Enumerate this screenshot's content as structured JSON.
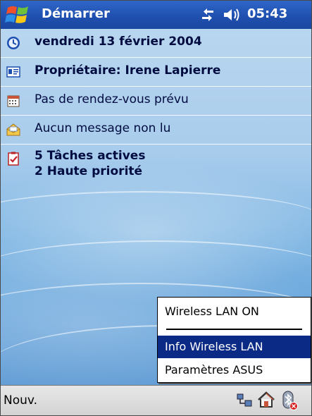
{
  "titlebar": {
    "start_label": "Démarrer",
    "time": "05:43"
  },
  "today": {
    "date": "vendredi 13 février 2004",
    "owner": "Propriétaire: Irene Lapierre",
    "appointments": "Pas de rendez-vous prévu",
    "messages": "Aucun message non lu",
    "tasks_line1": "5 Tâches actives",
    "tasks_line2": "2 Haute priorité"
  },
  "popup_menu": {
    "items": [
      "Wireless LAN ON",
      "Info Wireless LAN",
      "Paramètres ASUS"
    ],
    "selected": "Info Wireless LAN"
  },
  "bottombar": {
    "new_label": "Nouv."
  },
  "colors": {
    "title_bar": "#1f4fae",
    "menu_highlight": "#0a2a86",
    "text_dark": "#000c40"
  },
  "icons": [
    "windows-flag-icon",
    "connectivity-icon",
    "speaker-icon",
    "clock-icon",
    "owner-card-icon",
    "calendar-icon",
    "inbox-icon",
    "tasks-icon",
    "network-icon",
    "home-icon",
    "bluetooth-icon"
  ]
}
